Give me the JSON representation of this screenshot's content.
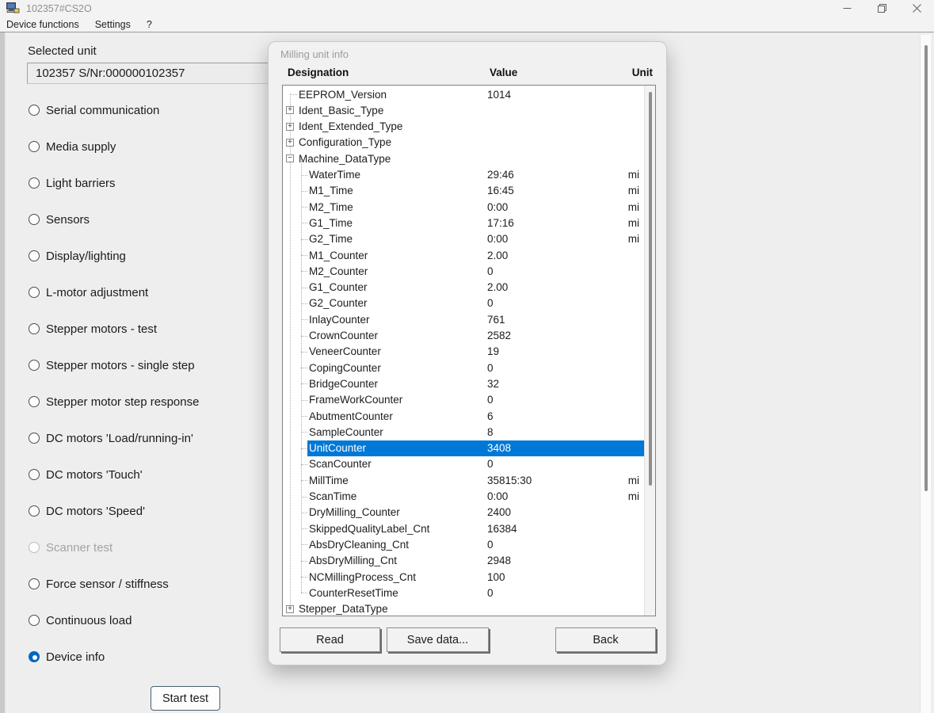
{
  "window": {
    "title": "102357#CS2O",
    "controls": {
      "minimize": "minimize",
      "restore": "restore",
      "close": "close"
    }
  },
  "menu": {
    "items": [
      "Device functions",
      "Settings",
      "?"
    ]
  },
  "sidebar": {
    "selected_unit_label": "Selected unit",
    "selected_unit_value": "102357 S/Nr:000000102357",
    "tests": [
      {
        "label": "Serial communication",
        "disabled": false,
        "selected": false
      },
      {
        "label": "Media supply",
        "disabled": false,
        "selected": false
      },
      {
        "label": "Light barriers",
        "disabled": false,
        "selected": false
      },
      {
        "label": "Sensors",
        "disabled": false,
        "selected": false
      },
      {
        "label": "Display/lighting",
        "disabled": false,
        "selected": false
      },
      {
        "label": "L-motor adjustment",
        "disabled": false,
        "selected": false
      },
      {
        "label": "Stepper motors - test",
        "disabled": false,
        "selected": false
      },
      {
        "label": "Stepper motors - single step",
        "disabled": false,
        "selected": false
      },
      {
        "label": "Stepper motor step response",
        "disabled": false,
        "selected": false
      },
      {
        "label": "DC motors 'Load/running-in'",
        "disabled": false,
        "selected": false
      },
      {
        "label": "DC motors 'Touch'",
        "disabled": false,
        "selected": false
      },
      {
        "label": "DC motors 'Speed'",
        "disabled": false,
        "selected": false
      },
      {
        "label": "Scanner test",
        "disabled": true,
        "selected": false
      },
      {
        "label": "Force sensor / stiffness",
        "disabled": false,
        "selected": false
      },
      {
        "label": "Continuous load",
        "disabled": false,
        "selected": false
      },
      {
        "label": "Device info",
        "disabled": false,
        "selected": true
      }
    ],
    "start_test_label": "Start test"
  },
  "dialog": {
    "title": "Milling unit info",
    "columns": [
      "Designation",
      "Value",
      "Unit"
    ],
    "buttons": [
      "Read",
      "Save data...",
      "Back"
    ],
    "tree": [
      {
        "label": "EEPROM_Version",
        "level": 0,
        "exp": "leaf",
        "value": "1014",
        "unit": "",
        "selected": false
      },
      {
        "label": "Ident_Basic_Type",
        "level": 0,
        "exp": "plus",
        "value": "",
        "unit": "",
        "selected": false
      },
      {
        "label": "Ident_Extended_Type",
        "level": 0,
        "exp": "plus",
        "value": "",
        "unit": "",
        "selected": false
      },
      {
        "label": "Configuration_Type",
        "level": 0,
        "exp": "plus",
        "value": "",
        "unit": "",
        "selected": false
      },
      {
        "label": "Machine_DataType",
        "level": 0,
        "exp": "minus",
        "value": "",
        "unit": "",
        "selected": false
      },
      {
        "label": "WaterTime",
        "level": 1,
        "exp": "leaf",
        "value": "29:46",
        "unit": "mi",
        "selected": false
      },
      {
        "label": "M1_Time",
        "level": 1,
        "exp": "leaf",
        "value": "16:45",
        "unit": "mi",
        "selected": false
      },
      {
        "label": "M2_Time",
        "level": 1,
        "exp": "leaf",
        "value": "0:00",
        "unit": "mi",
        "selected": false
      },
      {
        "label": "G1_Time",
        "level": 1,
        "exp": "leaf",
        "value": "17:16",
        "unit": "mi",
        "selected": false
      },
      {
        "label": "G2_Time",
        "level": 1,
        "exp": "leaf",
        "value": "0:00",
        "unit": "mi",
        "selected": false
      },
      {
        "label": "M1_Counter",
        "level": 1,
        "exp": "leaf",
        "value": "2.00",
        "unit": "",
        "selected": false
      },
      {
        "label": "M2_Counter",
        "level": 1,
        "exp": "leaf",
        "value": "0",
        "unit": "",
        "selected": false
      },
      {
        "label": "G1_Counter",
        "level": 1,
        "exp": "leaf",
        "value": "2.00",
        "unit": "",
        "selected": false
      },
      {
        "label": "G2_Counter",
        "level": 1,
        "exp": "leaf",
        "value": "0",
        "unit": "",
        "selected": false
      },
      {
        "label": "InlayCounter",
        "level": 1,
        "exp": "leaf",
        "value": "761",
        "unit": "",
        "selected": false
      },
      {
        "label": "CrownCounter",
        "level": 1,
        "exp": "leaf",
        "value": "2582",
        "unit": "",
        "selected": false
      },
      {
        "label": "VeneerCounter",
        "level": 1,
        "exp": "leaf",
        "value": "19",
        "unit": "",
        "selected": false
      },
      {
        "label": "CopingCounter",
        "level": 1,
        "exp": "leaf",
        "value": "0",
        "unit": "",
        "selected": false
      },
      {
        "label": "BridgeCounter",
        "level": 1,
        "exp": "leaf",
        "value": "32",
        "unit": "",
        "selected": false
      },
      {
        "label": "FrameWorkCounter",
        "level": 1,
        "exp": "leaf",
        "value": "0",
        "unit": "",
        "selected": false
      },
      {
        "label": "AbutmentCounter",
        "level": 1,
        "exp": "leaf",
        "value": "6",
        "unit": "",
        "selected": false
      },
      {
        "label": "SampleCounter",
        "level": 1,
        "exp": "leaf",
        "value": "8",
        "unit": "",
        "selected": false
      },
      {
        "label": "UnitCounter",
        "level": 1,
        "exp": "leaf",
        "value": "3408",
        "unit": "",
        "selected": true
      },
      {
        "label": "ScanCounter",
        "level": 1,
        "exp": "leaf",
        "value": "0",
        "unit": "",
        "selected": false
      },
      {
        "label": "MillTime",
        "level": 1,
        "exp": "leaf",
        "value": "35815:30",
        "unit": "mi",
        "selected": false
      },
      {
        "label": "ScanTime",
        "level": 1,
        "exp": "leaf",
        "value": "0:00",
        "unit": "mi",
        "selected": false
      },
      {
        "label": "DryMilling_Counter",
        "level": 1,
        "exp": "leaf",
        "value": "2400",
        "unit": "",
        "selected": false
      },
      {
        "label": "SkippedQualityLabel_Cnt",
        "level": 1,
        "exp": "leaf",
        "value": "16384",
        "unit": "",
        "selected": false
      },
      {
        "label": "AbsDryCleaning_Cnt",
        "level": 1,
        "exp": "leaf",
        "value": "0",
        "unit": "",
        "selected": false
      },
      {
        "label": "AbsDryMilling_Cnt",
        "level": 1,
        "exp": "leaf",
        "value": "2948",
        "unit": "",
        "selected": false
      },
      {
        "label": "NCMillingProcess_Cnt",
        "level": 1,
        "exp": "leaf",
        "value": "100",
        "unit": "",
        "selected": false
      },
      {
        "label": "CounterResetTime",
        "level": 1,
        "exp": "leaf",
        "value": "0",
        "unit": "",
        "selected": false
      },
      {
        "label": "Stepper_DataType",
        "level": 0,
        "exp": "plus",
        "value": "",
        "unit": "",
        "selected": false
      }
    ]
  },
  "colors": {
    "selection": "#0078d7",
    "radio_accent": "#0067c0",
    "titlebar": "#f3f3f3",
    "dialog_bg": "#f1f1f1"
  }
}
